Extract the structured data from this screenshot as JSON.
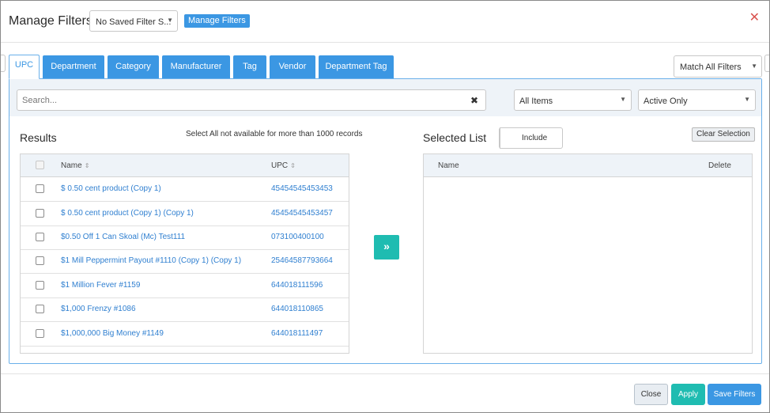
{
  "header": {
    "title": "Manage Filters",
    "saved_filter_value": "No Saved Filter S...",
    "manage_button": "Manage Filters",
    "close_glyph": "✕"
  },
  "tabs": [
    "UPC",
    "Department",
    "Category",
    "Manufacturer",
    "Tag",
    "Vendor",
    "Department Tag"
  ],
  "active_tab": "UPC",
  "match_select": "Match All Filters",
  "search": {
    "placeholder": "Search...",
    "value": "",
    "clear_glyph": "✖"
  },
  "items_filter": "All Items",
  "status_filter": "Active Only",
  "results": {
    "title": "Results",
    "note": "Select All not available for more than 1000 records",
    "columns": {
      "name": "Name",
      "upc": "UPC"
    },
    "rows": [
      {
        "name": "$ 0.50 cent product (Copy 1)",
        "upc": "45454545453453"
      },
      {
        "name": "$ 0.50 cent product (Copy 1) (Copy 1)",
        "upc": "45454545453457"
      },
      {
        "name": "$0.50 Off 1 Can Skoal (Mc) Test111",
        "upc": "073100400100"
      },
      {
        "name": "$1 Mill Peppermint Payout #1110 (Copy 1) (Copy 1)",
        "upc": "25464587793664"
      },
      {
        "name": "$1 Million Fever #1159",
        "upc": "644018111596"
      },
      {
        "name": "$1,000 Frenzy #1086",
        "upc": "644018110865"
      },
      {
        "name": "$1,000,000 Big Money #1149",
        "upc": "644018111497"
      }
    ]
  },
  "move_glyph": "»",
  "selected": {
    "title": "Selected List",
    "include_label": "Include",
    "clear_label": "Clear Selection",
    "columns": {
      "name": "Name",
      "delete": "Delete"
    }
  },
  "footer": {
    "close": "Close",
    "apply": "Apply",
    "save": "Save Filters"
  },
  "colors": {
    "primary": "#3b97e3",
    "teal": "#1fbcb1",
    "close_x": "#d9534f",
    "link": "#2f7fd0"
  }
}
